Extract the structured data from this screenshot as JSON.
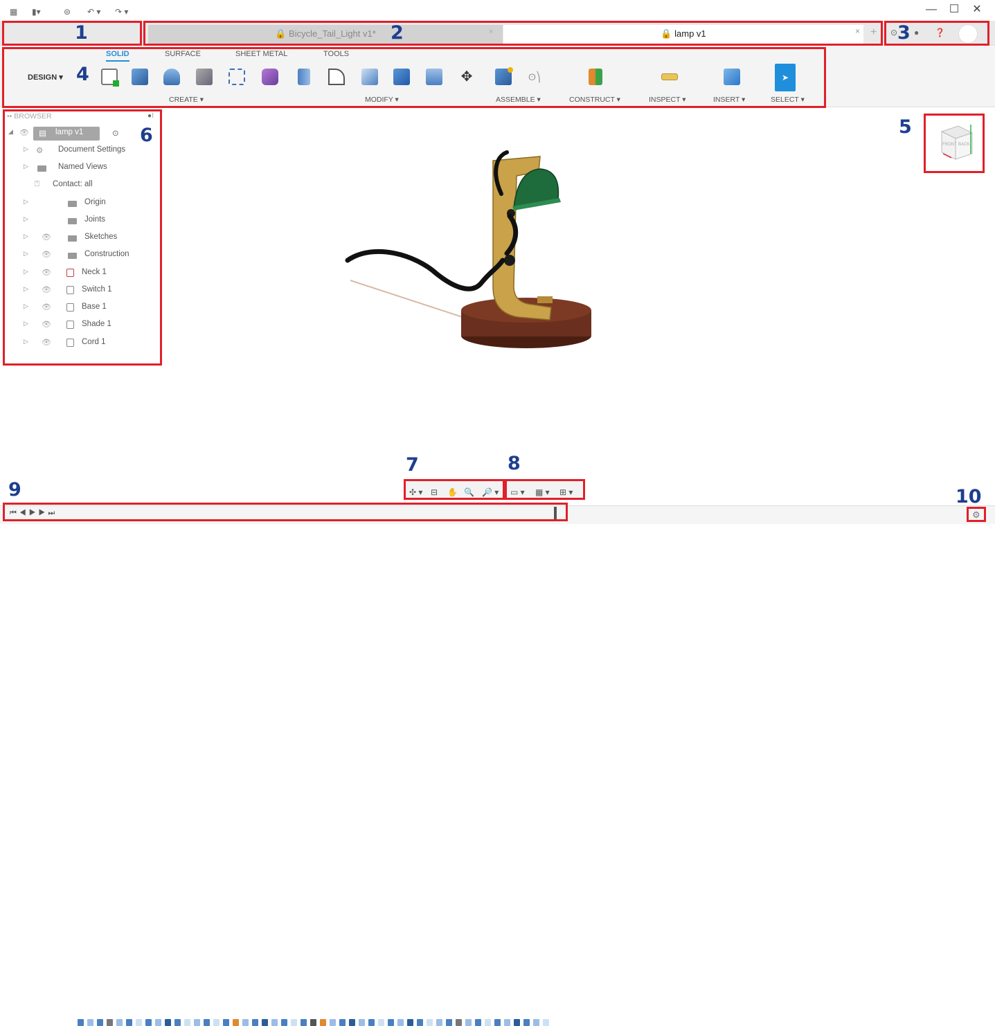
{
  "window": {
    "minimize": "—",
    "maximize": "☐",
    "close": "✕"
  },
  "tabs": [
    {
      "label": "Bicycle_Tail_Light v1*",
      "close": "×"
    },
    {
      "label": "lamp v1",
      "close": "×"
    }
  ],
  "new_tab": "+",
  "toolbar": {
    "workspace": "DESIGN ▾",
    "tabs": [
      "SOLID",
      "SURFACE",
      "SHEET METAL",
      "TOOLS"
    ],
    "groups": [
      "CREATE ▾",
      "MODIFY ▾",
      "ASSEMBLE ▾",
      "CONSTRUCT ▾",
      "INSPECT ▾",
      "INSERT ▾",
      "SELECT ▾"
    ]
  },
  "browser": {
    "title": "BROWSER",
    "root": "lamp v1",
    "items": [
      "Document Settings",
      "Named Views",
      "Contact: all",
      "Origin",
      "Joints",
      "Sketches",
      "Construction",
      "Neck 1",
      "Switch 1",
      "Base 1",
      "Shade 1",
      "Cord 1"
    ]
  },
  "viewcube": {
    "front": "FRONT",
    "back": "BACK"
  },
  "callouts": [
    "1",
    "2",
    "3",
    "4",
    "5",
    "6",
    "7",
    "8",
    "9",
    "10"
  ],
  "colors": {
    "callout_border": "#e0202a",
    "callout_number": "#1e3f8f",
    "accent": "#1f8fdb",
    "shade_green": "#1e6b3c",
    "brass": "#c9a24a",
    "wood": "#6a2f1e"
  },
  "icons": {
    "nav": [
      "orbit-icon",
      "pan-icon",
      "zoom-icon",
      "fit-icon"
    ],
    "display": [
      "display-settings-icon",
      "grid-icon",
      "viewports-icon"
    ]
  }
}
